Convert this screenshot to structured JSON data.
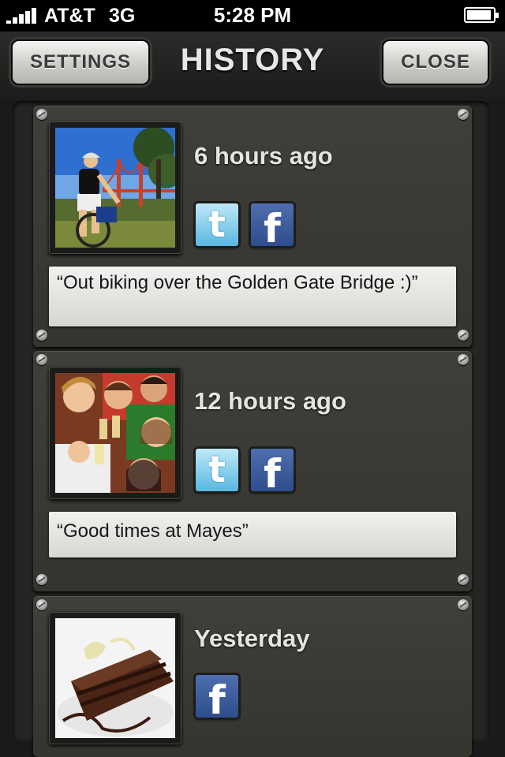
{
  "status_bar": {
    "carrier": "AT&T",
    "network": "3G",
    "time": "5:28 PM",
    "signal_bars": 5,
    "battery_level": 0.95
  },
  "nav": {
    "title": "HISTORY",
    "left_button": "SETTINGS",
    "right_button": "CLOSE"
  },
  "history": [
    {
      "time": "6 hours ago",
      "photo": "golden-gate-biker-photo",
      "networks": [
        "twitter",
        "facebook"
      ],
      "caption": "“Out biking over the Golden Gate Bridge :)”"
    },
    {
      "time": "12 hours ago",
      "photo": "friends-toasting-photo",
      "networks": [
        "twitter",
        "facebook"
      ],
      "caption": "“Good times at Mayes”"
    },
    {
      "time": "Yesterday",
      "photo": "chocolate-cake-photo",
      "networks": [
        "facebook"
      ],
      "caption": ""
    }
  ],
  "icons": {
    "twitter": "twitter-icon",
    "facebook": "facebook-icon"
  },
  "colors": {
    "twitter": "#58b8e0",
    "facebook": "#3b5998",
    "card": "#3b3a35"
  }
}
